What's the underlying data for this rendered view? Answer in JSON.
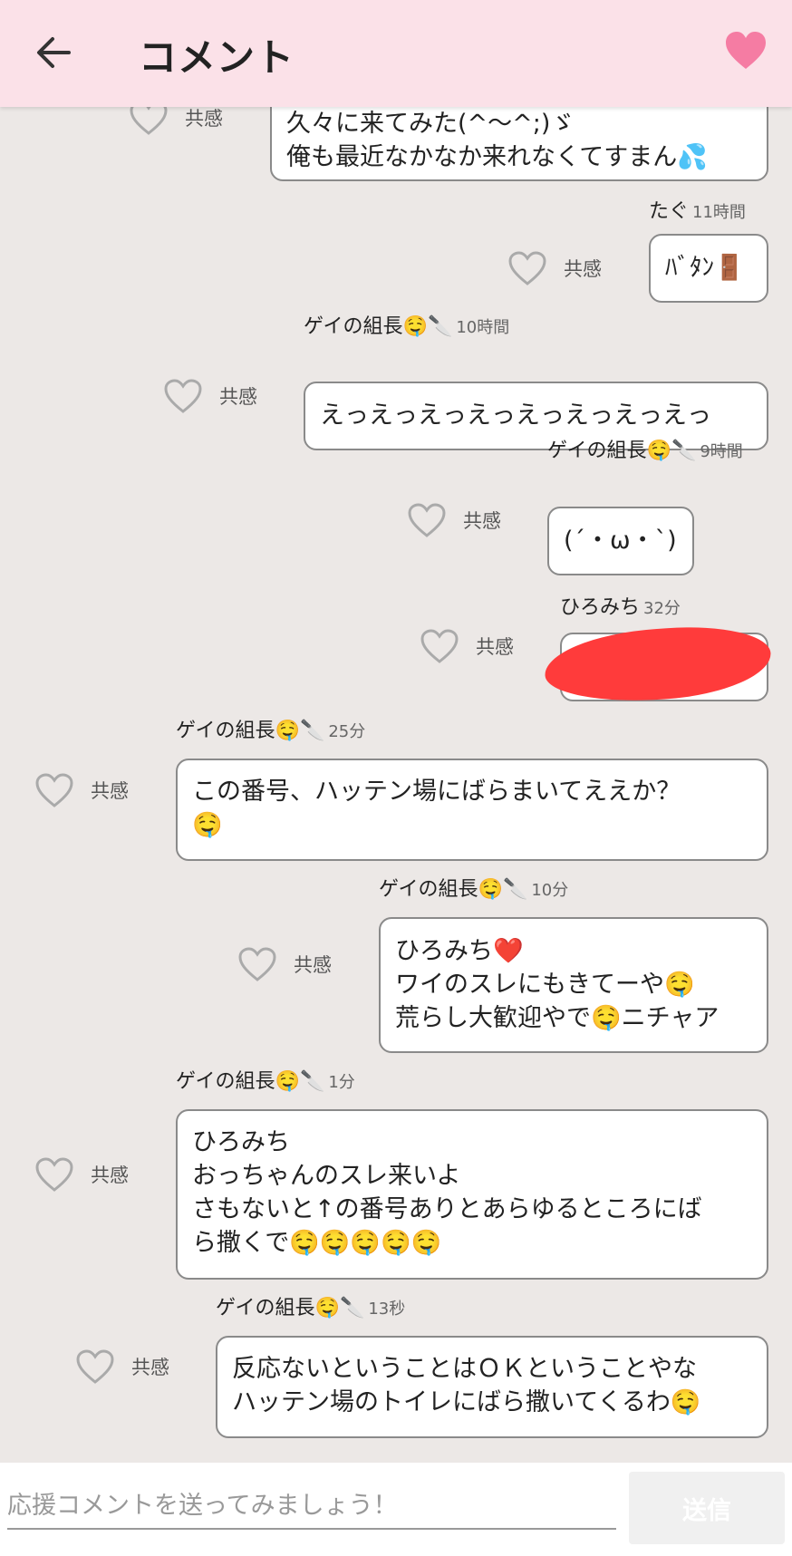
{
  "header": {
    "title": "コメント",
    "back_icon": "arrow-left-icon",
    "favorite_icon": "heart-icon",
    "favorite_color": "#f57ca3"
  },
  "like_label": "共感",
  "comments": [
    {
      "author": "",
      "time": "",
      "lines": [
        "久々に来てみた(^〜^;)ゞ",
        "俺も最近なかなか来れなくてすまん💦"
      ]
    },
    {
      "author": "たぐ",
      "time": "11時間",
      "lines": [
        "ﾊﾞﾀﾝ🚪"
      ]
    },
    {
      "author": "ゲイの組長",
      "author_emoji": "🤤🔪",
      "time": "10時間",
      "lines": [
        "えっえっえっえっえっえっえっえっ"
      ]
    },
    {
      "author": "ゲイの組長",
      "author_emoji": "🤤🔪",
      "time": "9時間",
      "lines": [
        "(´・ω・`)"
      ]
    },
    {
      "author": "ひろみち",
      "time": "32分",
      "lines": [
        ""
      ],
      "redacted": true,
      "redaction_color": "#ff3b3b"
    },
    {
      "author": "ゲイの組長",
      "author_emoji": "🤤🔪",
      "time": "25分",
      "lines": [
        "この番号、ハッテン場にばらまいてええか？",
        "🤤"
      ]
    },
    {
      "author": "ゲイの組長",
      "author_emoji": "🤤🔪",
      "time": "10分",
      "lines": [
        "ひろみち❤️",
        "ワイのスレにもきてーや🤤",
        "荒らし大歓迎やで🤤ニチャア"
      ]
    },
    {
      "author": "ゲイの組長",
      "author_emoji": "🤤🔪",
      "time": "1分",
      "lines": [
        "ひろみち",
        "おっちゃんのスレ来いよ",
        "さもないと↑の番号ありとあらゆるところにば",
        "ら撒くで🤤🤤🤤🤤🤤"
      ]
    },
    {
      "author": "ゲイの組長",
      "author_emoji": "🤤🔪",
      "time": "13秒",
      "lines": [
        "反応ないということはＯＫということやな",
        "ハッテン場のトイレにばら撒いてくるわ🤤"
      ]
    }
  ],
  "composer": {
    "placeholder": "応援コメントを送ってみましょう！",
    "send_label": "送信"
  }
}
